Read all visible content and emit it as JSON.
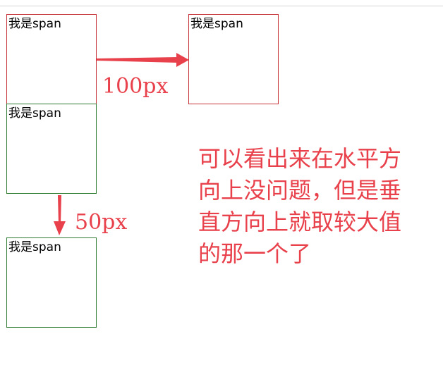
{
  "boxes": [
    {
      "label": "我是span",
      "border_color": "#c8323a"
    },
    {
      "label": "我是span",
      "border_color": "#c8323a"
    },
    {
      "label": "我是span",
      "border_color": "#2e7d32"
    },
    {
      "label": "我是span",
      "border_color": "#2e7d32"
    }
  ],
  "annotations": {
    "horizontal_gap": "100px",
    "vertical_gap": "50px",
    "note_lines": [
      "可以看出来在水平方",
      "向上没问题，但是垂",
      "直方向上就取较大值",
      "的那一个了"
    ],
    "color": "#e8414b"
  },
  "icons": {
    "horizontal": "arrow-right-icon",
    "vertical": "arrow-down-icon"
  }
}
